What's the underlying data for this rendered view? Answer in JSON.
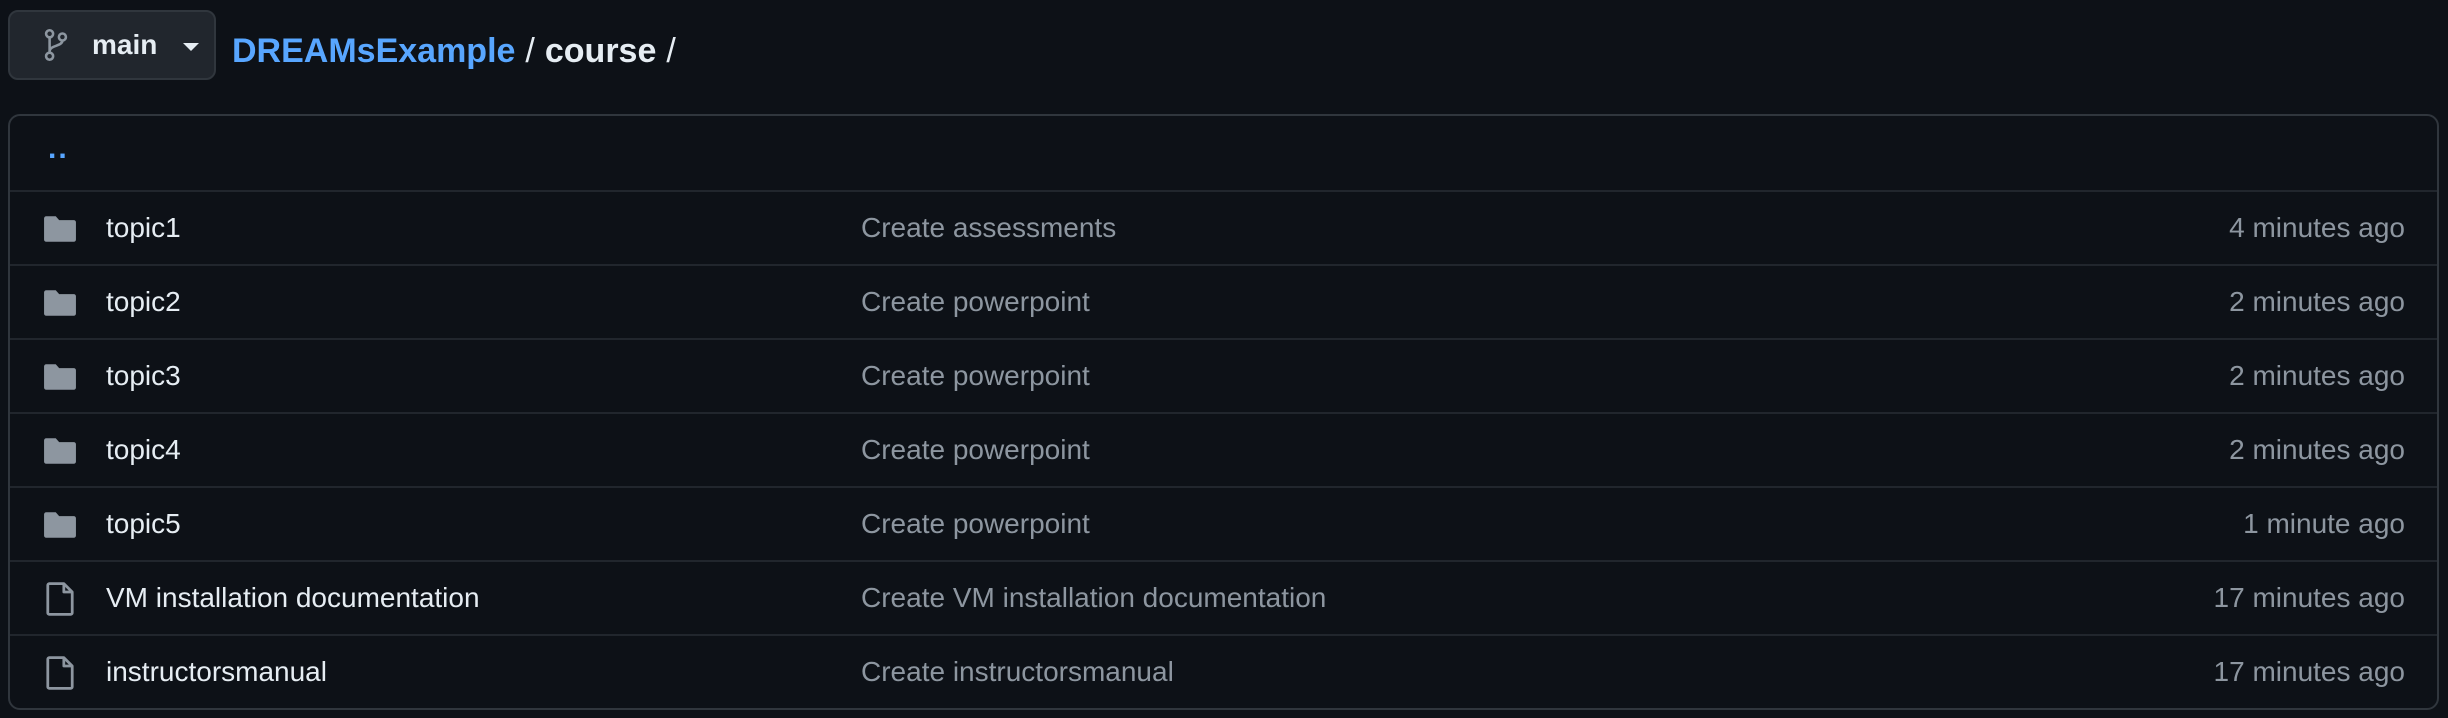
{
  "branch": {
    "name": "main",
    "icon": "git-branch-icon"
  },
  "breadcrumb": {
    "repo": "DREAMsExample",
    "separator": "/",
    "dir": "course",
    "trailing": "/"
  },
  "up_link": "..",
  "files": [
    {
      "type": "folder",
      "icon": "folder-icon",
      "name": "topic1",
      "message": "Create assessments",
      "time": "4 minutes ago"
    },
    {
      "type": "folder",
      "icon": "folder-icon",
      "name": "topic2",
      "message": "Create powerpoint",
      "time": "2 minutes ago"
    },
    {
      "type": "folder",
      "icon": "folder-icon",
      "name": "topic3",
      "message": "Create powerpoint",
      "time": "2 minutes ago"
    },
    {
      "type": "folder",
      "icon": "folder-icon",
      "name": "topic4",
      "message": "Create powerpoint",
      "time": "2 minutes ago"
    },
    {
      "type": "folder",
      "icon": "folder-icon",
      "name": "topic5",
      "message": "Create powerpoint",
      "time": "1 minute ago"
    },
    {
      "type": "file",
      "icon": "file-icon",
      "name": "VM installation documentation",
      "message": "Create VM installation documentation",
      "time": "17 minutes ago"
    },
    {
      "type": "file",
      "icon": "file-icon",
      "name": "instructorsmanual",
      "message": "Create instructorsmanual",
      "time": "17 minutes ago"
    }
  ],
  "colors": {
    "background": "#0d1117",
    "link": "#58a6ff",
    "muted": "#8d96a0",
    "border": "#30363d",
    "icon": "#8d96a0"
  }
}
